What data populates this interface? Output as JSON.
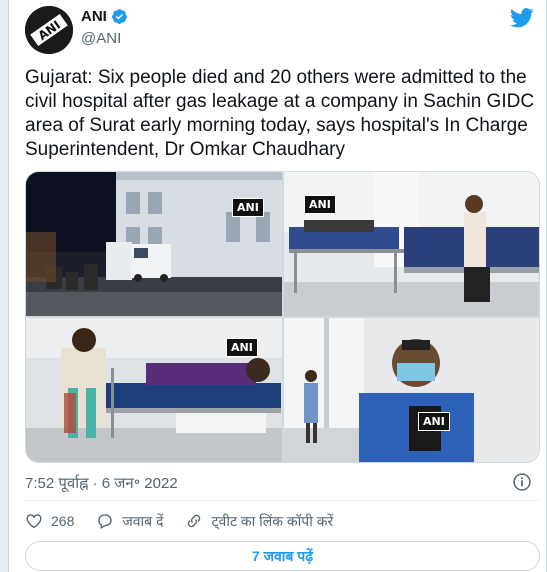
{
  "author": {
    "name": "ANI",
    "handle": "@ANI",
    "avatar_text": "ANI"
  },
  "tweet": {
    "text": "Gujarat: Six people died and 20 others were admitted to the civil hospital after gas leakage at a company in Sachin GIDC area of Surat early morning today, says hospital's In Charge Superintendent, Dr Omkar Chaudhary",
    "timestamp": "7:52 पूर्वाह्न · 6 जन॰ 2022"
  },
  "media": {
    "watermark": "ANI"
  },
  "actions": {
    "like_count": "268",
    "reply_label": "जवाब दें",
    "copy_link_label": "ट्वीट का लिंक कॉपी करें"
  },
  "more_replies_label": "7 जवाब पढ़ें",
  "colors": {
    "accent": "#1d9bf0",
    "secondary_text": "#536471",
    "border": "#cfd9de"
  }
}
